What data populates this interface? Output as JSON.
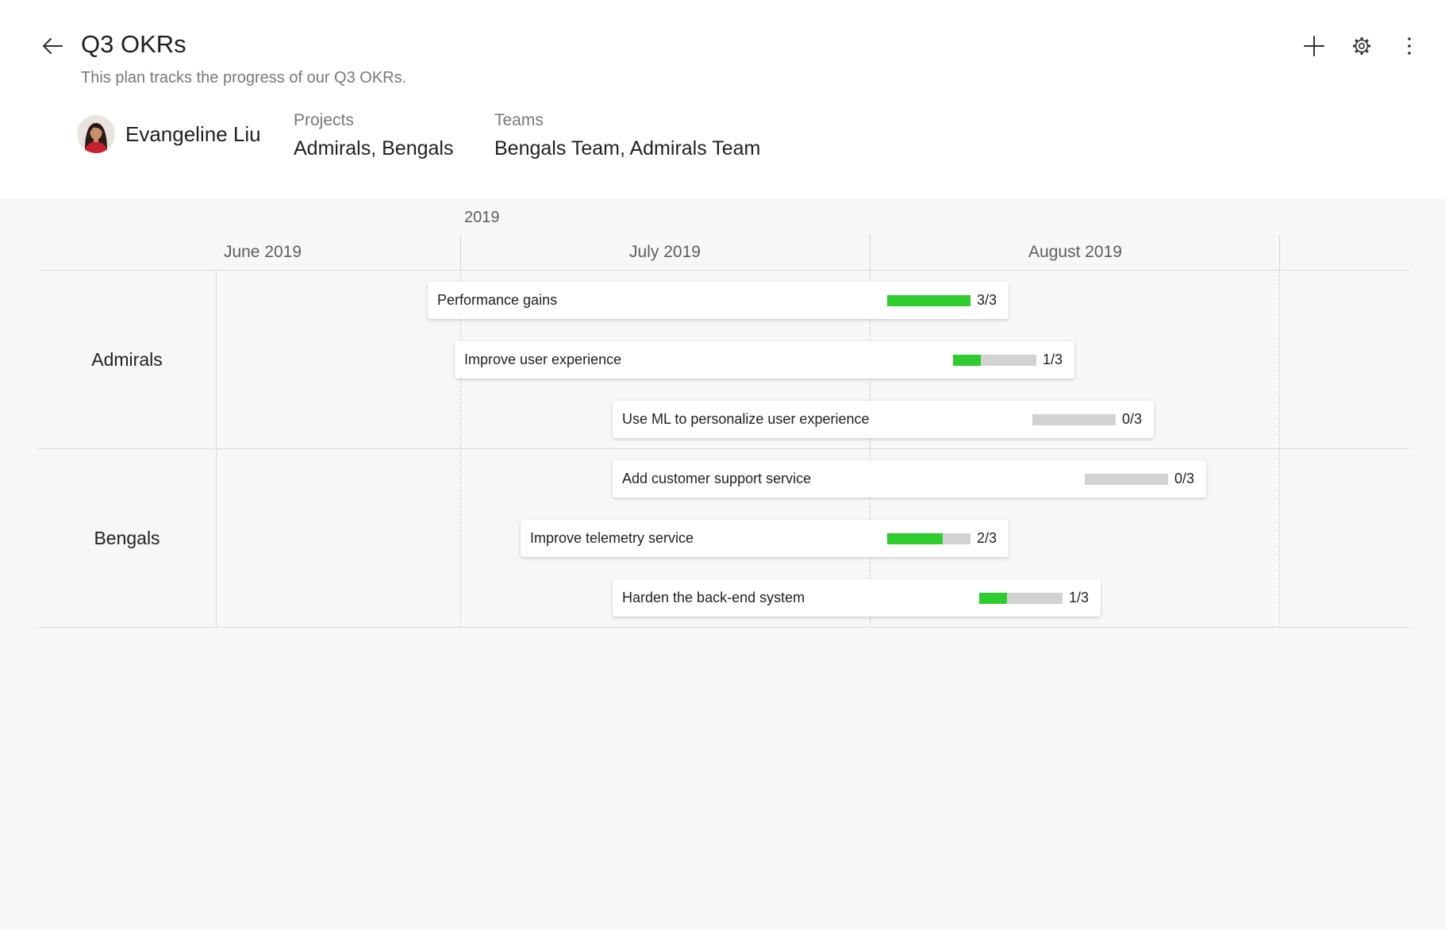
{
  "header": {
    "title": "Q3 OKRs",
    "subtitle": "This plan tracks the progress of our Q3 OKRs.",
    "owner": {
      "name": "Evangeline Liu"
    },
    "projects": {
      "label": "Projects",
      "value": "Admirals, Bengals"
    },
    "teams": {
      "label": "Teams",
      "value": "Bengals Team, Admirals Team"
    },
    "icons": {
      "back": "back-arrow-icon",
      "add": "plus-icon",
      "settings": "gear-icon",
      "more": "more-vertical-icon"
    }
  },
  "timeline": {
    "year": "2019",
    "months": [
      "June 2019",
      "July 2019",
      "August 2019"
    ]
  },
  "colors": {
    "progress_fill": "#2ecc2e",
    "progress_track": "#d2d2d2"
  },
  "groups": [
    {
      "name": "Admirals",
      "items": [
        {
          "title": "Performance gains",
          "progress": "3/3",
          "done": 3,
          "total": 3
        },
        {
          "title": "Improve user experience",
          "progress": "1/3",
          "done": 1,
          "total": 3
        },
        {
          "title": "Use ML to personalize user experience",
          "progress": "0/3",
          "done": 0,
          "total": 3
        }
      ]
    },
    {
      "name": "Bengals",
      "items": [
        {
          "title": "Add customer support service",
          "progress": "0/3",
          "done": 0,
          "total": 3
        },
        {
          "title": "Improve telemetry service",
          "progress": "2/3",
          "done": 2,
          "total": 3
        },
        {
          "title": "Harden the back-end system",
          "progress": "1/3",
          "done": 1,
          "total": 3
        }
      ]
    }
  ]
}
